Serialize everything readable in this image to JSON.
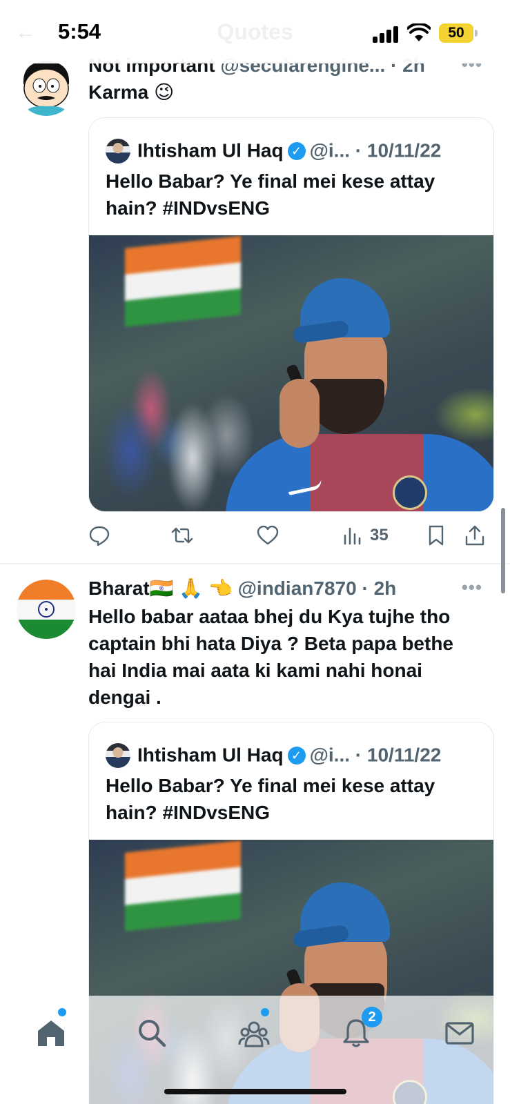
{
  "status_bar": {
    "time": "5:54",
    "battery": "50"
  },
  "header": {
    "title": "Quotes",
    "back_icon": "back-arrow-icon"
  },
  "tweets": [
    {
      "author": "Not important",
      "handle": "@secularengine...",
      "time": "2h",
      "text": "Karma 😉",
      "quote": {
        "author": "Ihtisham Ul Haq",
        "handle": "@i...",
        "date": "10/11/22",
        "text": "Hello Babar? Ye final mei kese attay hain? #INDvsENG"
      },
      "views": "35"
    },
    {
      "author": "Bharat🇮🇳 🙏 👈",
      "handle": "@indian7870",
      "time": "2h",
      "text": "Hello babar aataa bhej du Kya tujhe tho captain bhi hata Diya ?  Beta papa bethe hai India mai aata ki kami nahi honai dengai .",
      "quote": {
        "author": "Ihtisham Ul Haq",
        "handle": "@i...",
        "date": "10/11/22",
        "text": "Hello Babar? Ye final mei kese attay hain? #INDvsENG"
      }
    }
  ],
  "more_label": "•••",
  "separator": "·",
  "nav": {
    "items": [
      "home-icon",
      "search-icon",
      "communities-icon",
      "notifications-icon",
      "messages-icon"
    ],
    "notification_count": "2"
  },
  "colors": {
    "accent": "#1d9bf0",
    "text": "#0f1419",
    "secondary": "#536471"
  }
}
